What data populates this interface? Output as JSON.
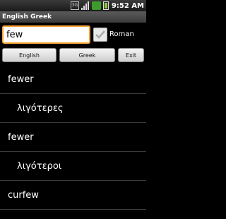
{
  "status": {
    "network": "3G",
    "time": "9:52 AM"
  },
  "app": {
    "title": "English Greek"
  },
  "search": {
    "value": "few",
    "roman_label": "Roman",
    "roman_checked": true
  },
  "buttons": {
    "english": "English",
    "greek": "Greek",
    "exit": "Exit"
  },
  "results": [
    {
      "lang": "en",
      "text": "fewer"
    },
    {
      "lang": "gr",
      "text": "λιγότερες"
    },
    {
      "lang": "en",
      "text": "fewer"
    },
    {
      "lang": "gr",
      "text": "λιγότεροι"
    },
    {
      "lang": "en",
      "text": "curfew"
    }
  ]
}
